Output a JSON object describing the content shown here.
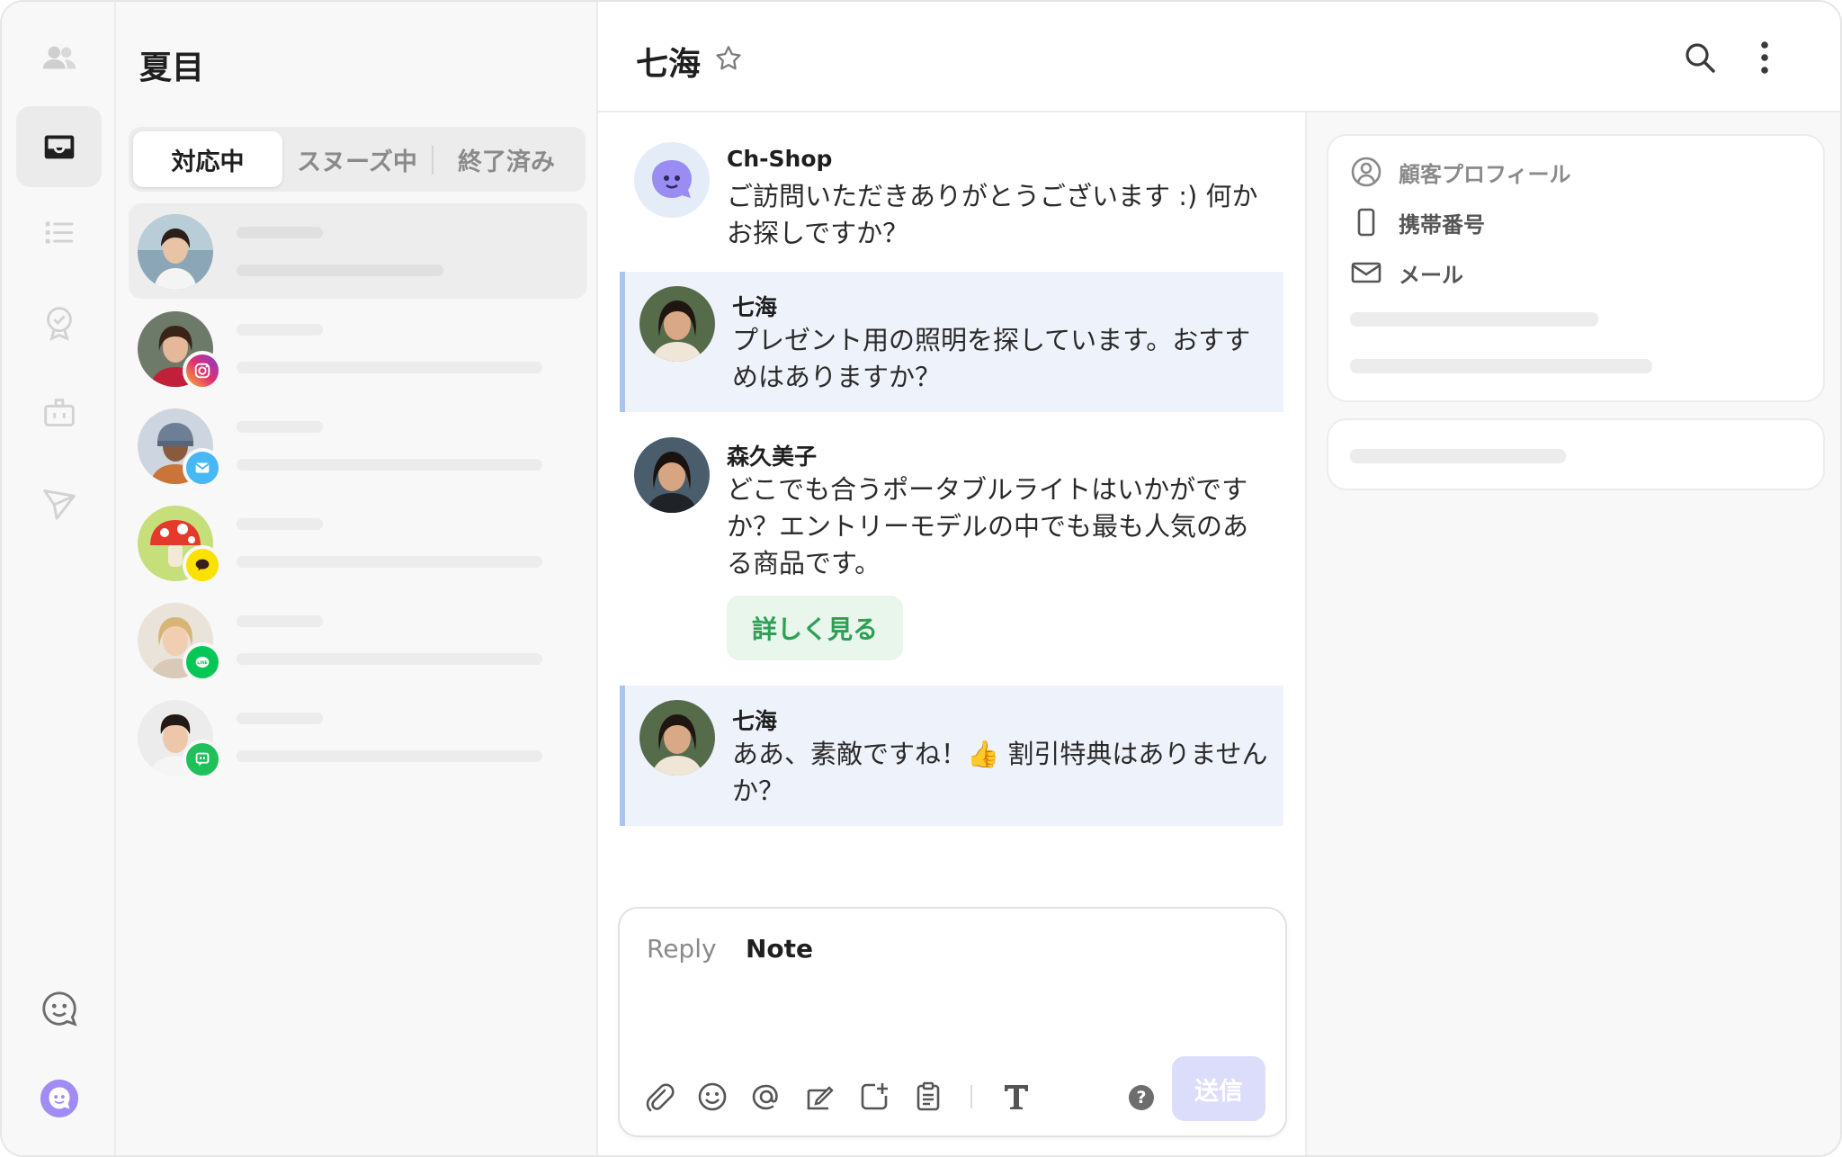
{
  "rail": {
    "items": [
      {
        "icon": "team-icon",
        "active": false
      },
      {
        "icon": "inbox-icon",
        "active": true
      },
      {
        "icon": "list-icon",
        "active": false
      },
      {
        "icon": "badge-check-icon",
        "active": false
      },
      {
        "icon": "bot-icon",
        "active": false
      },
      {
        "icon": "send-icon",
        "active": false
      }
    ],
    "bottom": [
      "face-icon",
      "app-logo-icon"
    ]
  },
  "list": {
    "title": "夏目",
    "tabs": [
      {
        "label": "対応中",
        "active": true
      },
      {
        "label": "スヌーズ中",
        "active": false
      },
      {
        "label": "終了済み",
        "active": false
      }
    ],
    "conversations": [
      {
        "channel": "none",
        "selected": true
      },
      {
        "channel": "instagram-icon",
        "selected": false
      },
      {
        "channel": "email-icon",
        "selected": false
      },
      {
        "channel": "kakao-icon",
        "selected": false
      },
      {
        "channel": "line-icon",
        "selected": false
      },
      {
        "channel": "sms-icon",
        "selected": false
      }
    ]
  },
  "chat": {
    "title": "七海",
    "messages": [
      {
        "sender": "Ch-Shop",
        "type": "bot",
        "text": "ご訪問いただきありがとうございます :) 何かお探しですか？"
      },
      {
        "sender": "七海",
        "type": "customer",
        "text": "プレゼント用の照明を探しています。おすすめはありますか？"
      },
      {
        "sender": "森久美子",
        "type": "agent",
        "text": "どこでも合うポータブルライトはいかがですか？エントリーモデルの中でも最も人気のある商品です。",
        "button": "詳しく見る"
      },
      {
        "sender": "七海",
        "type": "customer",
        "text": "ああ、素敵ですね！👍 割引特典はありませんか？"
      }
    ],
    "composer": {
      "tab_reply": "Reply",
      "tab_note": "Note",
      "send": "送信",
      "help": "?",
      "tools": [
        "attach-icon",
        "emoji-icon",
        "mention-icon",
        "template-icon",
        "add-card-icon",
        "clipboard-icon",
        "text-format-icon"
      ]
    }
  },
  "profile": {
    "title": "顧客プロフィール",
    "phone": "携帯番号",
    "email": "メール"
  },
  "colors": {
    "accent": "#8b7ff0",
    "customer_bubble": "#eef3fb",
    "customer_bar": "#a9c4ee",
    "success_green": "#2e9f55"
  }
}
